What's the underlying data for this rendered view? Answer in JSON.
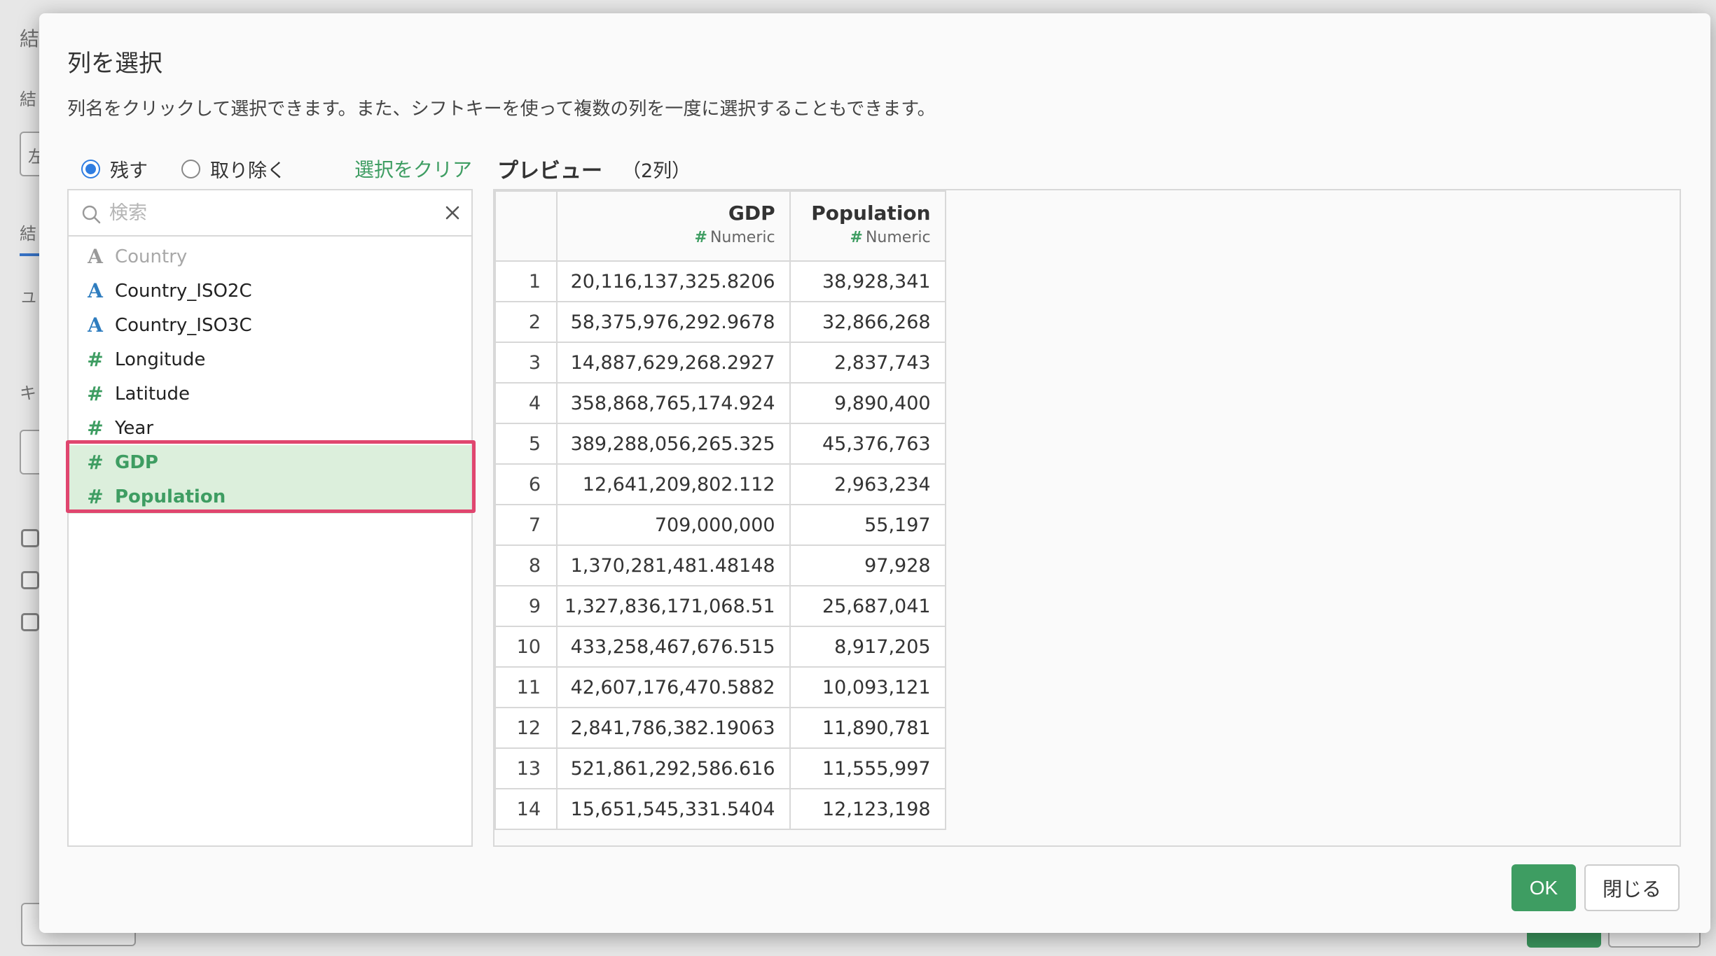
{
  "background": {
    "glyphs": [
      "結",
      "結",
      "左",
      "結",
      "ユ",
      "キ"
    ]
  },
  "dialog": {
    "title": "列を選択",
    "description": "列名をクリックして選択できます。また、シフトキーを使って複数の列を一度に選択することもできます。",
    "mode": {
      "keep_label": "残す",
      "remove_label": "取り除く",
      "selected": "keep"
    },
    "clear_selection": "選択をクリア",
    "search": {
      "placeholder": "検索",
      "value": ""
    },
    "columns": [
      {
        "type": "A",
        "name": "Country",
        "state": "disabled"
      },
      {
        "type": "A",
        "name": "Country_ISO2C",
        "state": "normal"
      },
      {
        "type": "A",
        "name": "Country_ISO3C",
        "state": "normal"
      },
      {
        "type": "#",
        "name": "Longitude",
        "state": "normal"
      },
      {
        "type": "#",
        "name": "Latitude",
        "state": "normal"
      },
      {
        "type": "#",
        "name": "Year",
        "state": "normal"
      },
      {
        "type": "#",
        "name": "GDP",
        "state": "selected"
      },
      {
        "type": "#",
        "name": "Population",
        "state": "selected"
      }
    ],
    "preview": {
      "title": "プレビュー",
      "count": "（2列）",
      "headers": [
        {
          "name": "GDP",
          "type_icon": "#",
          "type": "Numeric"
        },
        {
          "name": "Population",
          "type_icon": "#",
          "type": "Numeric"
        }
      ],
      "rows": [
        [
          "1",
          "20,116,137,325.8206",
          "38,928,341"
        ],
        [
          "2",
          "58,375,976,292.9678",
          "32,866,268"
        ],
        [
          "3",
          "14,887,629,268.2927",
          "2,837,743"
        ],
        [
          "4",
          "358,868,765,174.924",
          "9,890,400"
        ],
        [
          "5",
          "389,288,056,265.325",
          "45,376,763"
        ],
        [
          "6",
          "12,641,209,802.112",
          "2,963,234"
        ],
        [
          "7",
          "709,000,000",
          "55,197"
        ],
        [
          "8",
          "1,370,281,481.48148",
          "97,928"
        ],
        [
          "9",
          "1,327,836,171,068.51",
          "25,687,041"
        ],
        [
          "10",
          "433,258,467,676.515",
          "8,917,205"
        ],
        [
          "11",
          "42,607,176,470.5882",
          "10,093,121"
        ],
        [
          "12",
          "2,841,786,382.19063",
          "11,890,781"
        ],
        [
          "13",
          "521,861,292,586.616",
          "11,555,997"
        ],
        [
          "14",
          "15,651,545,331.5404",
          "12,123,198"
        ]
      ]
    },
    "buttons": {
      "ok": "OK",
      "close": "閉じる"
    },
    "colors": {
      "accent_green": "#3e9d62",
      "radio_blue": "#2f7de1",
      "highlight_pink": "#e0466f",
      "selected_bg": "#dcefdc",
      "string_type_blue": "#2f7dbf"
    }
  }
}
